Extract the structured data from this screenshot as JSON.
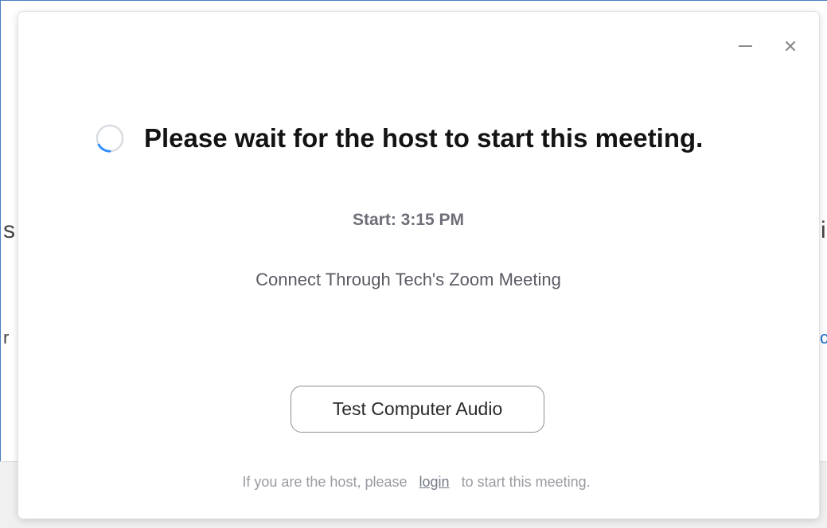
{
  "background_window": {
    "fragments": {
      "left_top": "s",
      "left_bottom": "r",
      "right_top": "i",
      "right_bottom": "c"
    }
  },
  "dialog": {
    "window_controls": {
      "minimize_icon": "minimize-icon",
      "close_icon": "close-icon",
      "close_glyph": "×"
    },
    "spinner_icon": "loading-spinner-icon",
    "wait_message": "Please wait for the host to start this meeting.",
    "start_time": "Start: 3:15 PM",
    "meeting_name": "Connect Through Tech's Zoom Meeting",
    "test_audio_button": "Test Computer Audio",
    "footer": {
      "prefix": "If you are the host, please",
      "login_link": "login",
      "suffix": "to start this meeting."
    }
  },
  "colors": {
    "spinner_accent": "#2d8cff",
    "spinner_track": "#d8dbe0",
    "window_border": "#4a7ebf"
  }
}
